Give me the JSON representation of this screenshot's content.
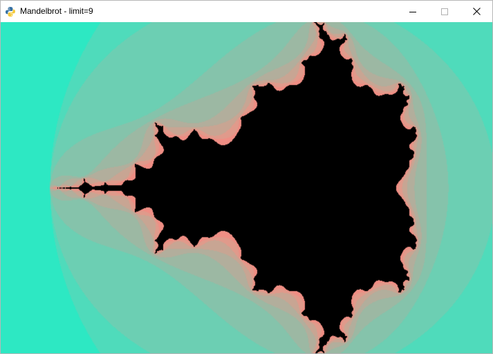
{
  "window": {
    "title": "Mandelbrot - limit=9",
    "app_icon": "python-icon",
    "controls": {
      "minimize": "minimize-icon",
      "maximize": "maximize-icon",
      "close": "close-icon"
    }
  },
  "fractal": {
    "type": "mandelbrot",
    "limit": 9,
    "inside_color": "#000000",
    "palette": [
      "#ef8e84",
      "#e09a8b",
      "#c8a593",
      "#b2ae9c",
      "#9cb8a3",
      "#85c3ab",
      "#6ccfb3",
      "#4fdbbb",
      "#2de8c3",
      "#1cf0c6"
    ],
    "background_color": "#1ff2c5"
  }
}
